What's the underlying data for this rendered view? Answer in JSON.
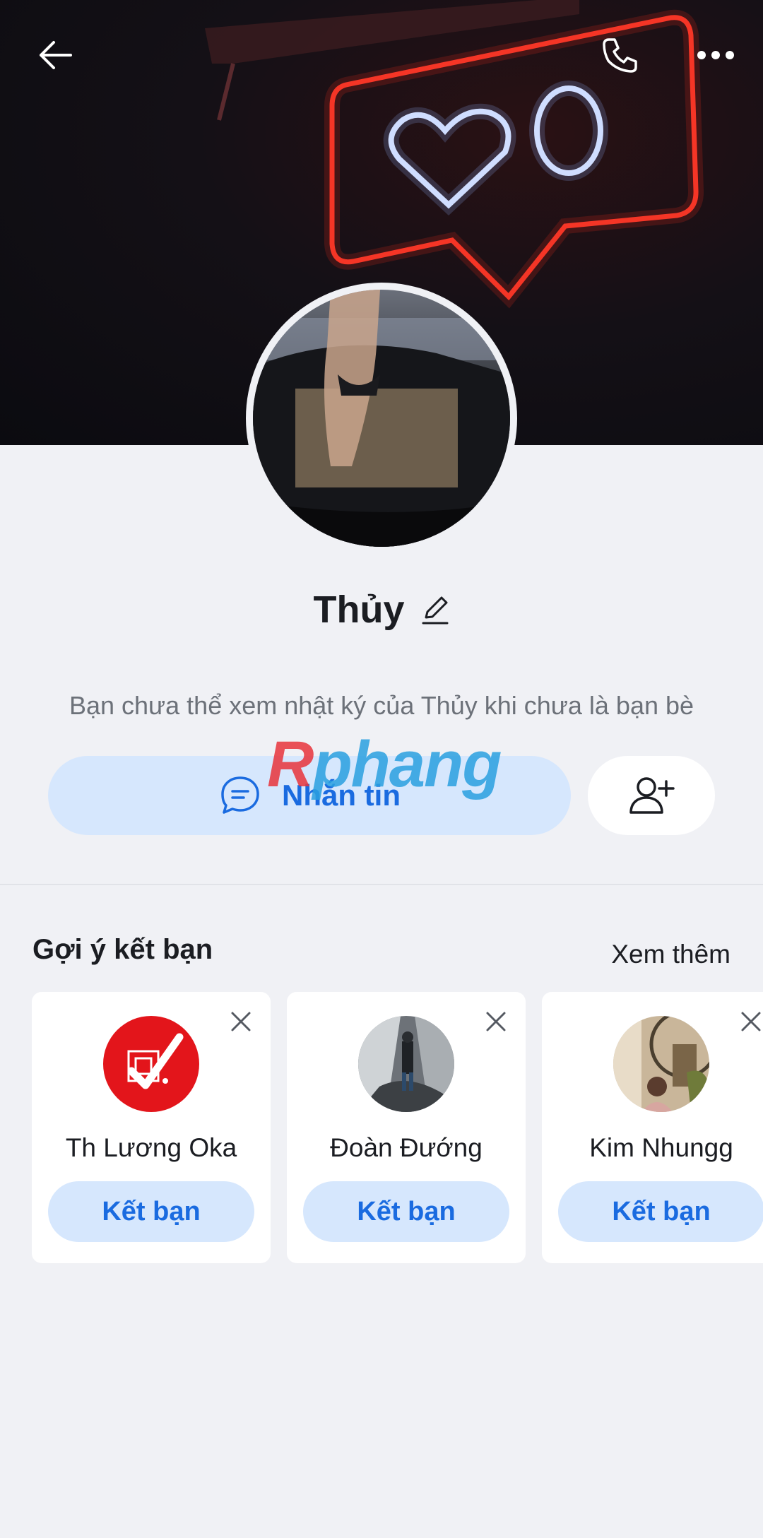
{
  "header": {
    "back_icon": "arrow-left-icon",
    "call_icon": "phone-icon",
    "more_icon": "more-horizontal-icon"
  },
  "profile": {
    "name": "Thủy",
    "edit_icon": "pencil-icon",
    "notice": "Bạn chưa thể xem nhật ký của Thủy khi chưa là bạn bè"
  },
  "actions": {
    "message_label": "Nhắn tin",
    "message_icon": "chat-bubble-icon",
    "add_friend_icon": "add-user-icon"
  },
  "watermark": {
    "first": "R",
    "rest": "phang"
  },
  "suggestions": {
    "title": "Gợi ý kết bạn",
    "see_more": "Xem thêm",
    "items": [
      {
        "name": "Th Lương Oka",
        "button": "Kết bạn"
      },
      {
        "name": "Đoàn Đướng",
        "button": "Kết bạn"
      },
      {
        "name": "Kim Nhungg",
        "button": "Kết bạn"
      }
    ]
  },
  "colors": {
    "accent": "#1a6be0",
    "button_bg": "#d6e7fd",
    "page_bg": "#f0f1f5"
  }
}
